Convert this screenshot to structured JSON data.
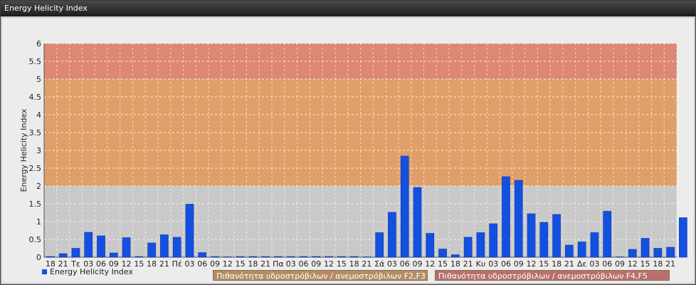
{
  "window": {
    "title": "Energy Helicity Index"
  },
  "legend": {
    "series_label": "Energy Helicity Index",
    "series_color": "#1450e0"
  },
  "bands": [
    {
      "label": "Πιθανότητα υδροστρόβιλων / ανεμοστρόβιλων F2,F3",
      "from": 2,
      "to": 5,
      "color": "#e29a5e",
      "box_color": "#b58c66"
    },
    {
      "label": "Πιθανότητα υδροστρόβιλων / ανεμοστρόβιλων F4,F5",
      "from": 5,
      "to": 6,
      "color": "#e0806a",
      "box_color": "#b8706a"
    }
  ],
  "chart_data": {
    "type": "bar",
    "title": "",
    "xlabel": "",
    "ylabel": "Energy Helicity Index",
    "ylim": [
      0,
      6
    ],
    "yticks": [
      "0",
      "0.5",
      "1",
      "1.5",
      "2",
      "2.5",
      "3",
      "3.5",
      "4",
      "4.5",
      "5",
      "5.5",
      "6"
    ],
    "grid": true,
    "legend_position": "bottom-left",
    "categories": [
      "18",
      "21",
      "Τε",
      "03",
      "06",
      "09",
      "12",
      "15",
      "18",
      "21",
      "Πέ",
      "03",
      "06",
      "09",
      "12",
      "15",
      "18",
      "21",
      "Πα",
      "03",
      "06",
      "09",
      "12",
      "15",
      "18",
      "21",
      "Σά",
      "03",
      "06",
      "09",
      "12",
      "15",
      "18",
      "21",
      "Κυ",
      "03",
      "06",
      "09",
      "12",
      "15",
      "18",
      "21",
      "Δε",
      "03",
      "06",
      "09",
      "12",
      "15",
      "18",
      "21"
    ],
    "series": [
      {
        "name": "Energy Helicity Index",
        "values": [
          0.02,
          0.1,
          0.25,
          0.7,
          0.6,
          0.12,
          0.55,
          0.02,
          0.4,
          0.63,
          0.56,
          1.49,
          0.13,
          0.02,
          0.01,
          0.02,
          0.02,
          0.02,
          0.02,
          0.02,
          0.02,
          0.02,
          0.02,
          0.02,
          0.02,
          0.01,
          0.69,
          1.26,
          2.84,
          1.96,
          0.67,
          0.23,
          0.07,
          0.56,
          0.69,
          0.94,
          2.26,
          2.16,
          1.22,
          0.98,
          1.2,
          0.34,
          0.43,
          0.69,
          1.29,
          0.01,
          0.22,
          0.53,
          0.25,
          0.28,
          1.11
        ]
      }
    ]
  }
}
